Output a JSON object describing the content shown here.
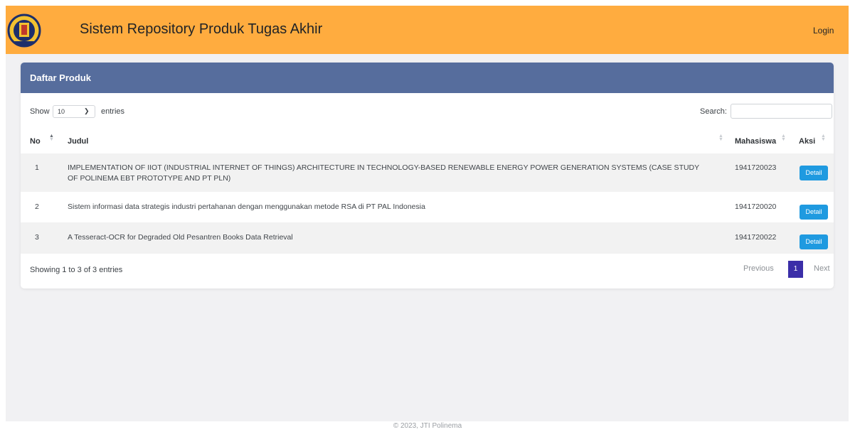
{
  "header": {
    "title": "Sistem Repository Produk Tugas Akhir",
    "login_label": "Login"
  },
  "card": {
    "title": "Daftar Produk",
    "show_label": "Show",
    "page_length": "10",
    "entries_label": "entries",
    "search_label": "Search:",
    "search_value": ""
  },
  "table": {
    "columns": [
      "No",
      "Judul",
      "Mahasiswa",
      "Aksi"
    ],
    "rows": [
      {
        "no": "1",
        "judul_line1": "IMPLEMENTATION OF IIOT (INDUSTRIAL INTERNET OF THINGS) ARCHITECTURE IN TECHNOLOGY-BASED RENEWABLE ENERGY POWER GENERATION SYSTEMS (CASE STUDY",
        "judul_line2": "OF POLINEMA EBT PROTOTYPE AND PT PLN)",
        "mahasiswa": "1941720023",
        "action": "Detail"
      },
      {
        "no": "2",
        "judul_line1": "Sistem informasi data strategis industri pertahanan dengan menggunakan metode RSA di PT PAL Indonesia",
        "judul_line2": "",
        "mahasiswa": "1941720020",
        "action": "Detail"
      },
      {
        "no": "3",
        "judul_line1": "A Tesseract-OCR for Degraded Old Pesantren Books Data Retrieval",
        "judul_line2": "",
        "mahasiswa": "1941720022",
        "action": "Detail"
      }
    ]
  },
  "pagination": {
    "info": "Showing 1 to 3 of 3 entries",
    "previous": "Previous",
    "current_page": "1",
    "next": "Next"
  },
  "footer": {
    "text": "© 2023, JTI Polinema"
  },
  "colors": {
    "navbar": "#ffac3f",
    "card_header": "#566d9d",
    "detail_button": "#1f9ae0",
    "active_page": "#3b2ea8"
  }
}
